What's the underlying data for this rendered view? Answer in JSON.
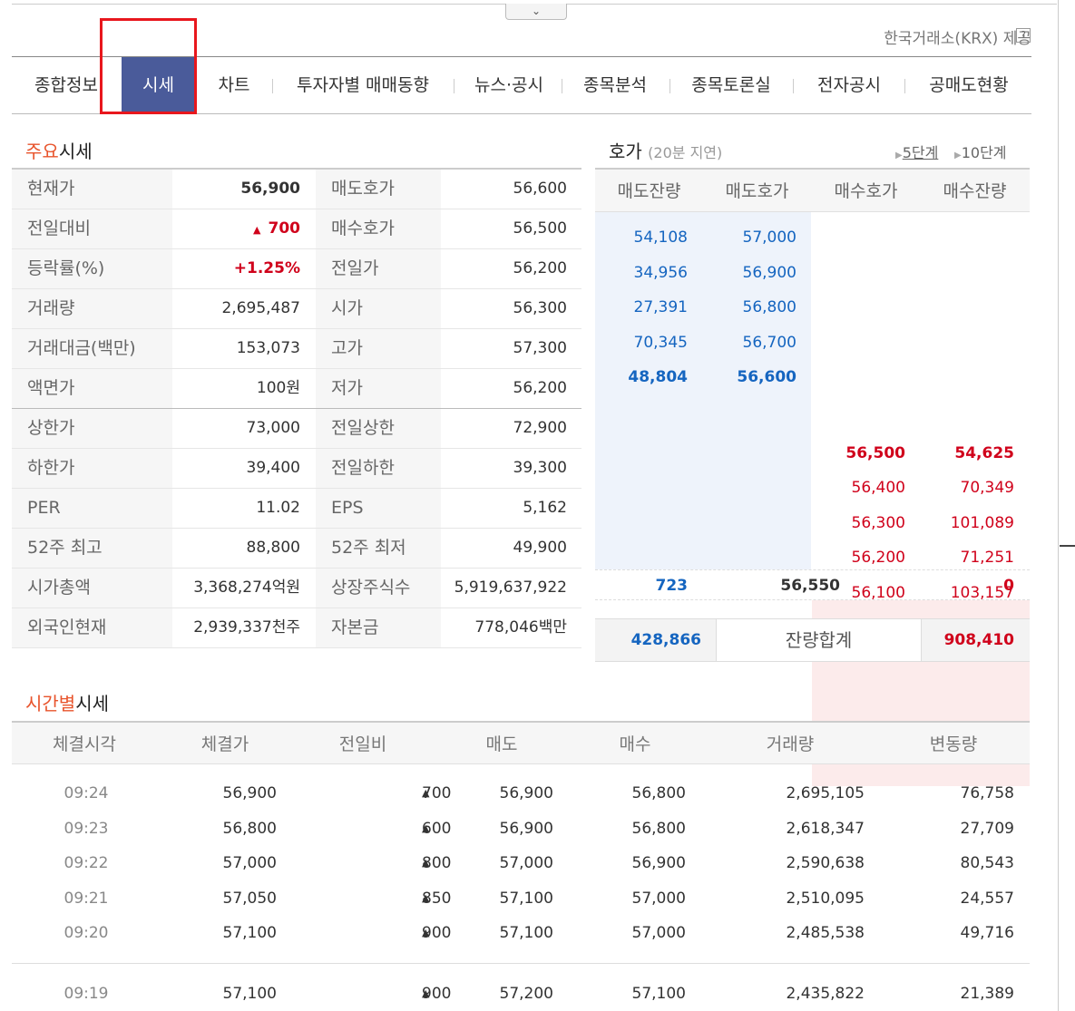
{
  "provider": "한국거래소(KRX) 제공",
  "help_icon": "?",
  "tabs": [
    "종합정보",
    "시세",
    "차트",
    "투자자별 매매동향",
    "뉴스·공시",
    "종목분석",
    "종목토론실",
    "전자공시",
    "공매도현황"
  ],
  "main_section": {
    "title_orange": "주요",
    "title_rest": "시세"
  },
  "main_rows": [
    {
      "l1": "현재가",
      "v1": "56,900",
      "l2": "매도호가",
      "v2": "56,600"
    },
    {
      "l1": "전일대비",
      "v1": "700",
      "l2": "매수호가",
      "v2": "56,500"
    },
    {
      "l1": "등락률(%)",
      "v1": "+1.25%",
      "l2": "전일가",
      "v2": "56,200"
    },
    {
      "l1": "거래량",
      "v1": "2,695,487",
      "l2": "시가",
      "v2": "56,300"
    },
    {
      "l1": "거래대금(백만)",
      "v1": "153,073",
      "l2": "고가",
      "v2": "57,300"
    },
    {
      "l1": "액면가",
      "v1": "100원",
      "l2": "저가",
      "v2": "56,200"
    },
    {
      "l1": "상한가",
      "v1": "73,000",
      "l2": "전일상한",
      "v2": "72,900"
    },
    {
      "l1": "하한가",
      "v1": "39,400",
      "l2": "전일하한",
      "v2": "39,300"
    },
    {
      "l1": "PER",
      "v1": "11.02",
      "l2": "EPS",
      "v2": "5,162"
    },
    {
      "l1": "52주 최고",
      "v1": "88,800",
      "l2": "52주 최저",
      "v2": "49,900"
    },
    {
      "l1": "시가총액",
      "v1": "3,368,274억원",
      "l2": "상장주식수",
      "v2": "5,919,637,922"
    },
    {
      "l1": "외국인현재",
      "v1": "2,939,337천주",
      "l2": "자본금",
      "v2": "778,046백만"
    }
  ],
  "orderbook": {
    "title": "호가",
    "delay": "(20분 지연)",
    "level5": "5단계",
    "level10": "10단계",
    "headers": [
      "매도잔량",
      "매도호가",
      "매수호가",
      "매수잔량"
    ],
    "asks": [
      {
        "qty": "54,108",
        "price": "57,000"
      },
      {
        "qty": "34,956",
        "price": "56,900"
      },
      {
        "qty": "27,391",
        "price": "56,800"
      },
      {
        "qty": "70,345",
        "price": "56,700"
      },
      {
        "qty": "48,804",
        "price": "56,600"
      }
    ],
    "mid": {
      "left": "723",
      "center": "56,550",
      "right": "0"
    },
    "bids": [
      {
        "price": "56,500",
        "qty": "54,625"
      },
      {
        "price": "56,400",
        "qty": "70,349"
      },
      {
        "price": "56,300",
        "qty": "101,089"
      },
      {
        "price": "56,200",
        "qty": "71,251"
      },
      {
        "price": "56,100",
        "qty": "103,157"
      }
    ],
    "total_ask": "428,866",
    "total_label": "잔량합계",
    "total_bid": "908,410"
  },
  "time_section": {
    "title_orange": "시간별",
    "title_rest": "시세"
  },
  "time_headers": [
    "체결시각",
    "체결가",
    "전일비",
    "매도",
    "매수",
    "거래량",
    "변동량"
  ],
  "time_rows": [
    {
      "time": "09:24",
      "price": "56,900",
      "change": "700",
      "ask": "56,900",
      "bid": "56,800",
      "volume": "2,695,105",
      "delta": "76,758"
    },
    {
      "time": "09:23",
      "price": "56,800",
      "change": "600",
      "ask": "56,900",
      "bid": "56,800",
      "volume": "2,618,347",
      "delta": "27,709"
    },
    {
      "time": "09:22",
      "price": "57,000",
      "change": "800",
      "ask": "57,000",
      "bid": "56,900",
      "volume": "2,590,638",
      "delta": "80,543"
    },
    {
      "time": "09:21",
      "price": "57,050",
      "change": "850",
      "ask": "57,100",
      "bid": "57,000",
      "volume": "2,510,095",
      "delta": "24,557"
    },
    {
      "time": "09:20",
      "price": "57,100",
      "change": "900",
      "ask": "57,100",
      "bid": "57,000",
      "volume": "2,485,538",
      "delta": "49,716"
    },
    {
      "time": "09:19",
      "price": "57,100",
      "change": "900",
      "ask": "57,200",
      "bid": "57,100",
      "volume": "2,435,822",
      "delta": "21,389"
    }
  ],
  "up_triangle": "▲",
  "collapse_icon": "chevron-down-icon",
  "colors": {
    "accent": "#4a5b9a",
    "up": "#d0021b",
    "down": "#1565c0",
    "highlight": "#e8171d"
  }
}
